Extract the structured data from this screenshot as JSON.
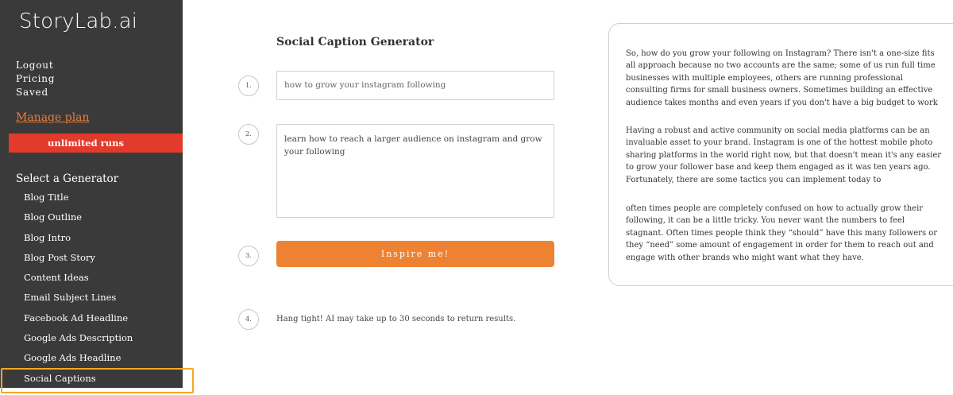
{
  "sidebar": {
    "logo": "StoryLab.ai",
    "links": [
      "Logout",
      "Pricing",
      "Saved"
    ],
    "manage_plan": "Manage plan",
    "plan_badge": "unlimited runs",
    "generator_heading": "Select a Generator",
    "generators": [
      "Blog Title",
      "Blog Outline",
      "Blog Intro",
      "Blog Post Story",
      "Content Ideas",
      "Email Subject Lines",
      "Facebook Ad Headline",
      "Google Ads Description",
      "Google Ads Headline",
      "Social Captions"
    ],
    "selected": "Social Captions"
  },
  "main": {
    "title": "Social Caption Generator",
    "steps": [
      "1.",
      "2.",
      "3.",
      "4."
    ],
    "input_value": "how to grow your instagram following",
    "textarea_value": "learn how to reach a larger audience on instagram and grow your following",
    "button_label": "Inspire me!",
    "wait_message": "Hang tight! AI may take up to 30 seconds to return results."
  },
  "output": {
    "paragraphs": [
      "So, how do you grow your following on Instagram? There isn't a one-size fits all approach because no two accounts are the same; some of us run full time businesses with multiple employees, others are running professional consulting firms for small business owners. Sometimes building an effective audience takes months and even years if you don't have a big budget to work",
      "Having a robust and active community on social media platforms can be an invaluable asset to your brand. Instagram is one of the hottest mobile photo sharing platforms in the world right now, but that doesn't mean it's any easier to grow your follower base and keep them engaged as it was ten years ago. Fortunately, there are some tactics you can implement today to",
      "often times people are completely confused on how to actually grow their following, it can be a little tricky. You never want the numbers to feel stagnant. Often times people think they “should” have this many followers or they “need” some amount of engagement in order for them to reach out and engage with other brands who might want what they have."
    ]
  },
  "colors": {
    "sidebar_bg": "#3b3a3a",
    "accent_orange": "#ee8233",
    "badge_red": "#e23a2b",
    "highlight_yellow": "#f4a825"
  }
}
